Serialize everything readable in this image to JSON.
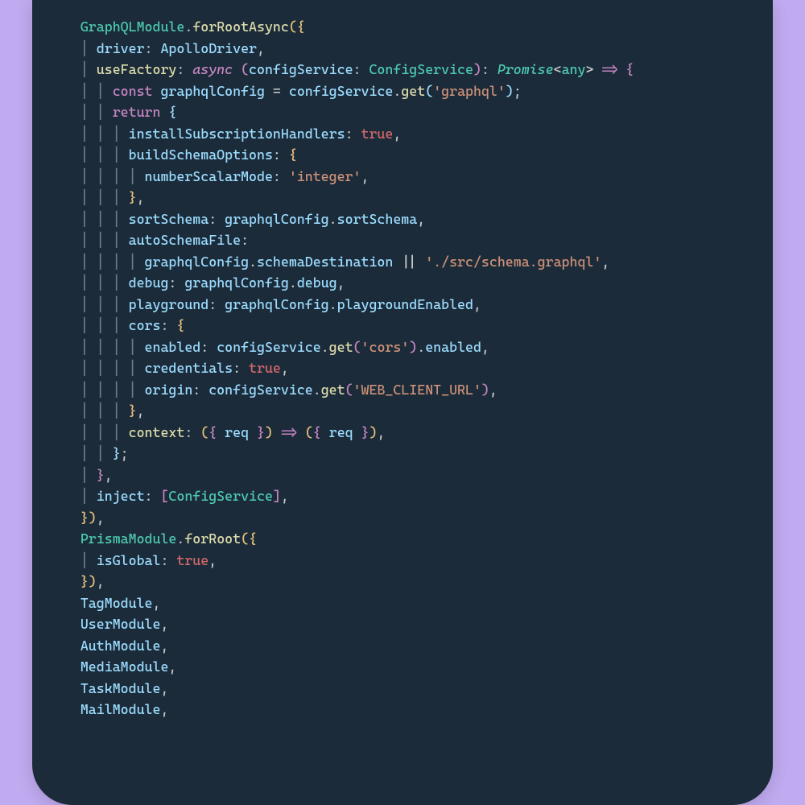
{
  "code": {
    "tokens": {
      "GraphQLModule": "GraphQLModule",
      "forRootAsync": "forRootAsync",
      "driver": "driver",
      "ApolloDriver": "ApolloDriver",
      "useFactory": "useFactory",
      "async": "async",
      "configService": "configService",
      "ConfigService": "ConfigService",
      "Promise": "Promise",
      "any": "any",
      "const": "const",
      "graphqlConfig": "graphqlConfig",
      "get": "get",
      "str_graphql": "'graphql'",
      "return": "return",
      "installSubscriptionHandlers": "installSubscriptionHandlers",
      "true": "true",
      "buildSchemaOptions": "buildSchemaOptions",
      "numberScalarMode": "numberScalarMode",
      "str_integer": "'integer'",
      "sortSchema": "sortSchema",
      "autoSchemaFile": "autoSchemaFile",
      "schemaDestination": "schemaDestination",
      "str_schemaPath": "'./src/schema.graphql'",
      "debug": "debug",
      "playground": "playground",
      "playgroundEnabled": "playgroundEnabled",
      "cors": "cors",
      "enabled": "enabled",
      "str_cors": "'cors'",
      "credentials": "credentials",
      "origin": "origin",
      "str_web": "'WEB_CLIENT_URL'",
      "context": "context",
      "req": "req",
      "inject": "inject",
      "PrismaModule": "PrismaModule",
      "forRoot": "forRoot",
      "isGlobal": "isGlobal",
      "TagModule": "TagModule",
      "UserModule": "UserModule",
      "AuthModule": "AuthModule",
      "MediaModule": "MediaModule",
      "TaskModule": "TaskModule",
      "MailModule": "MailModule"
    }
  }
}
